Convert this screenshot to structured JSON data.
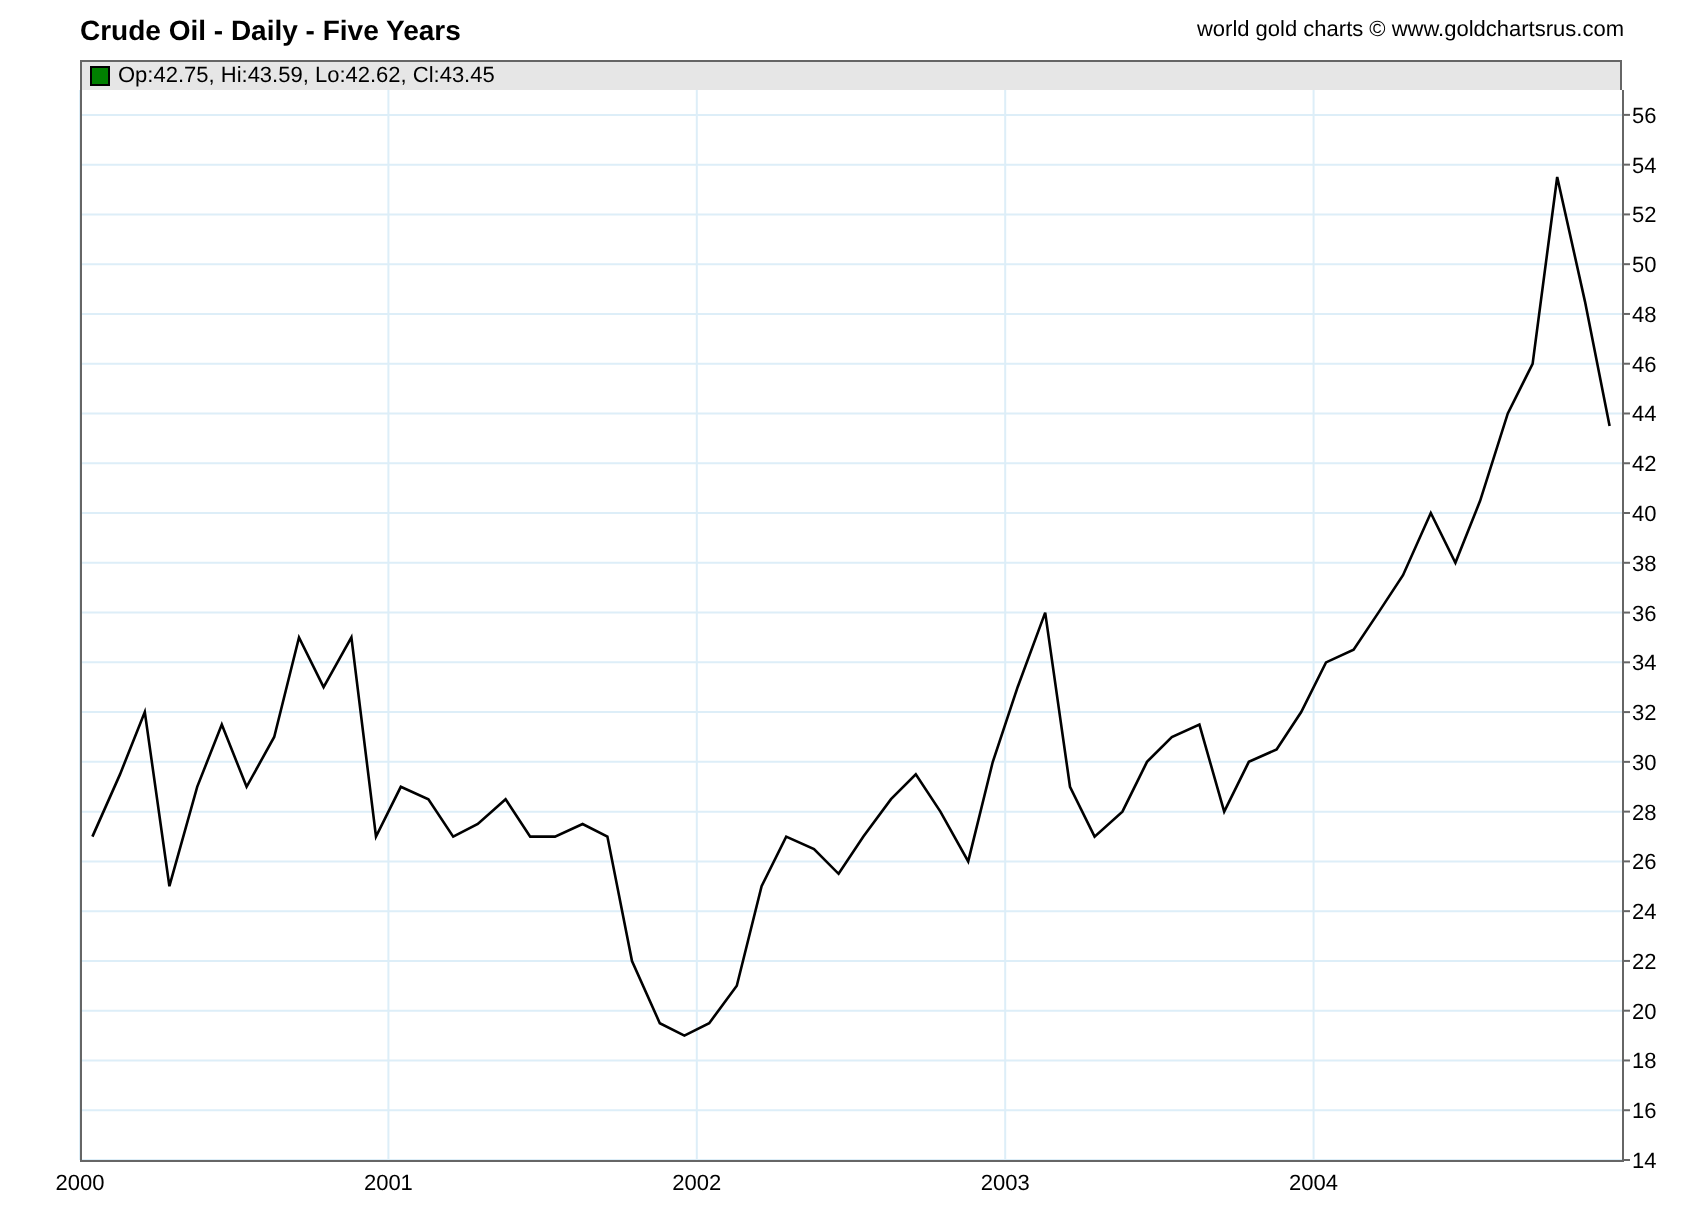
{
  "header": {
    "title": "Crude Oil - Daily - Five Years",
    "credit": "world gold charts © www.goldchartsrus.com"
  },
  "legend": {
    "text": "Op:42.75, Hi:43.59, Lo:42.62, Cl:43.45",
    "color": "#008000"
  },
  "chart_data": {
    "type": "line",
    "x": [
      2000.04,
      2000.13,
      2000.21,
      2000.29,
      2000.38,
      2000.46,
      2000.54,
      2000.63,
      2000.71,
      2000.79,
      2000.88,
      2000.96,
      2001.04,
      2001.13,
      2001.21,
      2001.29,
      2001.38,
      2001.46,
      2001.54,
      2001.63,
      2001.71,
      2001.79,
      2001.88,
      2001.96,
      2002.04,
      2002.13,
      2002.21,
      2002.29,
      2002.38,
      2002.46,
      2002.54,
      2002.63,
      2002.71,
      2002.79,
      2002.88,
      2002.96,
      2003.04,
      2003.13,
      2003.21,
      2003.29,
      2003.38,
      2003.46,
      2003.54,
      2003.63,
      2003.71,
      2003.79,
      2003.88,
      2003.96,
      2004.04,
      2004.13,
      2004.21,
      2004.29,
      2004.38,
      2004.46,
      2004.54,
      2004.63,
      2004.71,
      2004.79,
      2004.88,
      2004.96
    ],
    "series": [
      {
        "color": "#000000",
        "values": [
          27,
          29.5,
          32,
          25,
          29,
          31.5,
          29,
          31,
          35,
          33,
          35,
          27,
          29,
          28.5,
          27,
          27.5,
          28.5,
          27,
          27,
          27.5,
          27,
          22,
          19.5,
          19,
          19.5,
          21,
          25,
          27,
          26.5,
          25.5,
          27,
          28.5,
          29.5,
          28,
          26,
          30,
          33,
          36,
          29,
          27,
          28,
          30,
          31,
          31.5,
          28,
          30,
          30.5,
          32,
          34,
          34.5,
          36,
          37.5,
          40,
          38,
          40.5,
          44,
          46,
          53.5,
          48.5,
          43.5
        ]
      }
    ],
    "xlim": [
      2000,
      2005
    ],
    "ylim": [
      14,
      57
    ],
    "grid": true,
    "xticks": [
      2000,
      2001,
      2002,
      2003,
      2004
    ],
    "yticks": [
      14,
      16,
      18,
      20,
      22,
      24,
      26,
      28,
      30,
      32,
      34,
      36,
      38,
      40,
      42,
      44,
      46,
      48,
      50,
      52,
      54,
      56
    ]
  }
}
